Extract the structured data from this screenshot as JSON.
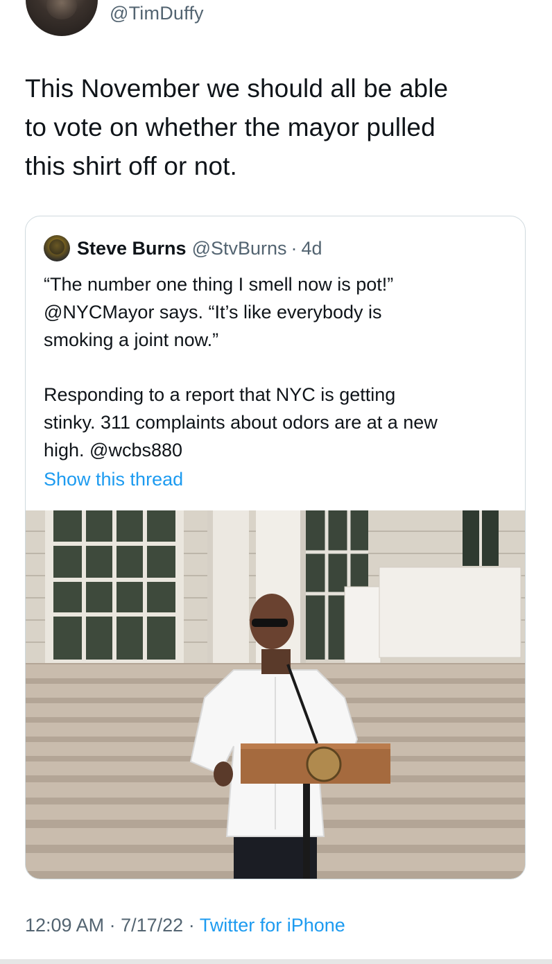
{
  "tweet": {
    "author_handle": "@TimDuffy",
    "text_lines": [
      "This November we should all be able",
      "to vote on whether the mayor pulled",
      "this shirt off or not."
    ],
    "time": "12:09 AM",
    "date": "7/17/22",
    "separator": "·",
    "source": "Twitter for iPhone"
  },
  "quote": {
    "name": "Steve Burns",
    "handle": "@StvBurns",
    "separator": "·",
    "age": "4d",
    "paragraph1_lines": [
      "“The number one thing I smell now is pot!”",
      "@NYCMayor says. “It’s like everybody is",
      "smoking a joint now.”"
    ],
    "paragraph2_lines": [
      "Responding to a report that NYC is getting",
      "stinky. 311 complaints about odors are at a new",
      "high. @wcbs880"
    ],
    "show_thread": "Show this thread"
  },
  "icons": {
    "author_avatar": "avatar",
    "quote_avatar": "avatar"
  },
  "colors": {
    "link": "#1d9bf0",
    "secondary_text": "#536471",
    "primary_text": "#0f1419",
    "border": "#cfd9de"
  }
}
